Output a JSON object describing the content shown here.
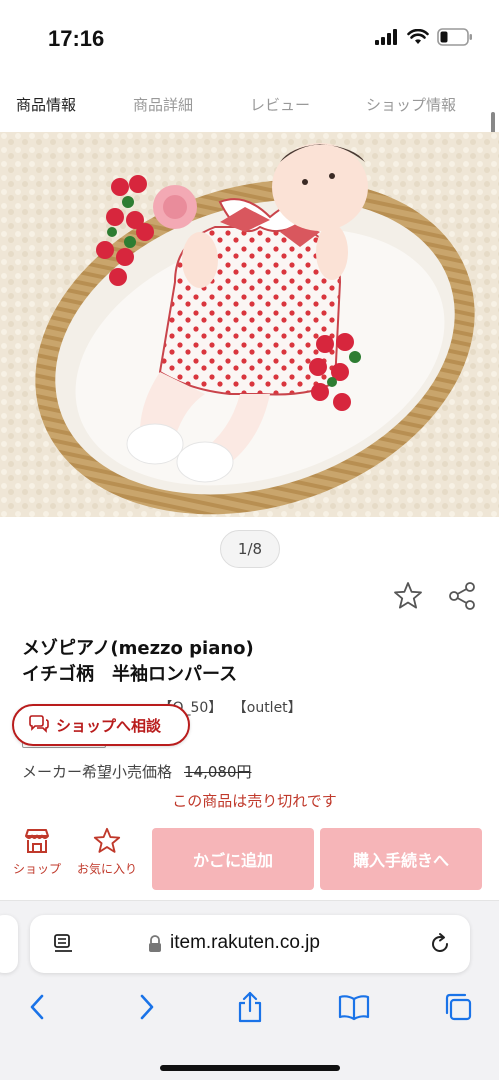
{
  "status": {
    "time": "17:16"
  },
  "tabs": [
    {
      "label": "商品情報",
      "active": true
    },
    {
      "label": "商品詳細",
      "active": false
    },
    {
      "label": "レビュー",
      "active": false
    },
    {
      "label": "ショップ情報",
      "active": false
    }
  ],
  "gallery": {
    "counter": "1/8"
  },
  "product": {
    "title_line1": "メゾピアノ(mezzo piano)",
    "title_line2": "イチゴ柄　半袖ロンパース",
    "tags": [
      "【O_50】",
      "【outlet】"
    ],
    "price_label": "メーカー希望小売価格",
    "price_value": "14,080円",
    "soldout_message": "この商品は売り切れです"
  },
  "consult_button": {
    "label": "ショップへ相談"
  },
  "actions": {
    "shop_label": "ショップ",
    "favorite_label": "お気に入り",
    "add_cart_label": "かごに追加",
    "checkout_label": "購入手続きへ"
  },
  "browser": {
    "url": "item.rakuten.co.jp"
  },
  "colors": {
    "accent": "#b91c1c",
    "disabled_button": "#f6b5b8",
    "soldout_text": "#c0392b"
  },
  "icons": {
    "status": [
      "signal-icon",
      "wifi-icon",
      "battery-icon"
    ],
    "product": [
      "star-outline-icon",
      "share-icon"
    ],
    "consult": "chat-bubbles-icon",
    "actions": [
      "shop-icon",
      "star-icon"
    ],
    "browser": [
      "reader-icon",
      "lock-icon",
      "reload-icon",
      "back-icon",
      "forward-icon",
      "share-upload-icon",
      "bookmarks-icon",
      "tabs-icon"
    ]
  }
}
